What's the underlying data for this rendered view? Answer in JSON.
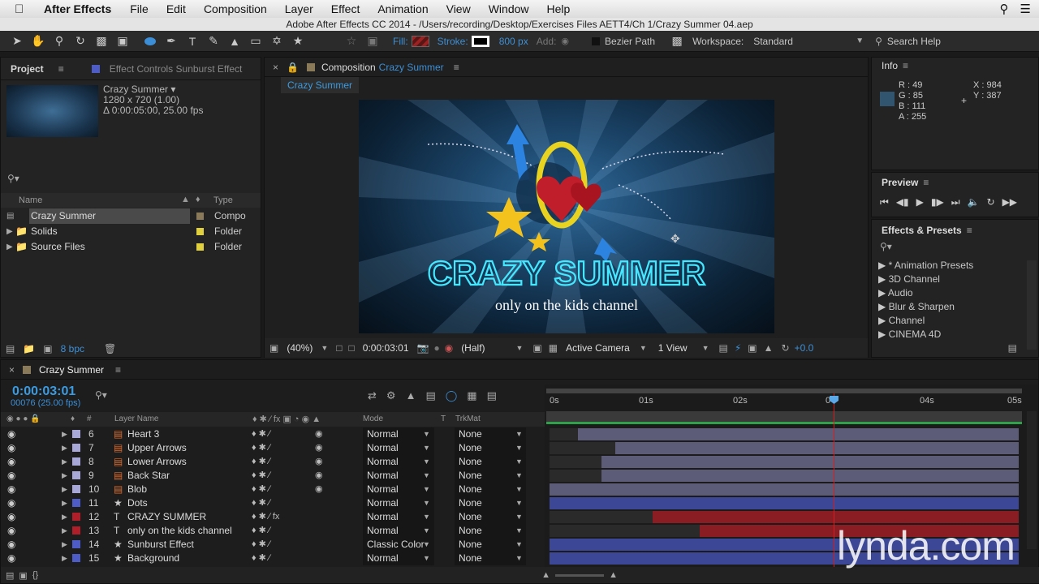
{
  "menubar": {
    "app_name": "After Effects",
    "items": [
      "File",
      "Edit",
      "Composition",
      "Layer",
      "Effect",
      "Animation",
      "View",
      "Window",
      "Help"
    ]
  },
  "titlebar": {
    "title": "Adobe After Effects CC 2014 - /Users/recording/Desktop/Exercises Files AETT4/Ch 1/Crazy Summer 04.aep"
  },
  "toolbar": {
    "fill_label": "Fill:",
    "stroke_label": "Stroke:",
    "stroke_width": "800 px",
    "add_label": "Add:",
    "bezier_label": "Bezier Path",
    "workspace_label": "Workspace:",
    "workspace_value": "Standard",
    "search_placeholder": "Search Help"
  },
  "project": {
    "tab_label": "Project",
    "effect_controls_label": "Effect Controls Sunburst Effect",
    "comp_name": "Crazy Summer ▾",
    "comp_size": "1280 x 720 (1.00)",
    "comp_duration": "Δ 0:00:05:00, 25.00 fps",
    "col_name": "Name",
    "col_type": "Type",
    "items": [
      {
        "name": "Crazy Summer",
        "type": "Compo",
        "color": "#8a7a5a",
        "selected": true
      },
      {
        "name": "Solids",
        "type": "Folder",
        "color": "#e0d040"
      },
      {
        "name": "Source Files",
        "type": "Folder",
        "color": "#e0d040"
      }
    ],
    "bpc": "8 bpc"
  },
  "composition": {
    "tab_prefix": "Composition",
    "tab_name": "Crazy Summer",
    "sub_tab": "Crazy Summer",
    "title_text": "CRAZY SUMMER",
    "subtitle_text": "only on the kids channel",
    "zoom": "(40%)",
    "timecode": "0:00:03:01",
    "resolution": "(Half)",
    "camera": "Active Camera",
    "views": "1 View",
    "exposure": "+0.0"
  },
  "info": {
    "tab_label": "Info",
    "r": "R : 49",
    "g": "G : 85",
    "b": "B : 111",
    "a": "A : 255",
    "x": "X : 984",
    "y": "Y : 387",
    "swatch": "#31556f"
  },
  "preview": {
    "tab_label": "Preview"
  },
  "effects": {
    "tab_label": "Effects & Presets",
    "items": [
      "▶ * Animation Presets",
      "▶ 3D Channel",
      "▶ Audio",
      "▶ Blur & Sharpen",
      "▶ Channel",
      "▶ CINEMA 4D"
    ]
  },
  "timeline": {
    "tab_label": "Crazy Summer",
    "timecode": "0:00:03:01",
    "frame_info": "00076 (25.00 fps)",
    "col_num": "#",
    "col_layer": "Layer Name",
    "col_mode": "Mode",
    "col_t": "T",
    "col_trkmat": "TrkMat",
    "ruler": [
      "0s",
      "01s",
      "02s",
      "0",
      "04s",
      "05s"
    ],
    "layers": [
      {
        "num": "6",
        "name": "Heart 3",
        "mode": "Normal",
        "trk": "None",
        "color": "#a8a8d8",
        "icon": "ai"
      },
      {
        "num": "7",
        "name": "Upper Arrows",
        "mode": "Normal",
        "trk": "None",
        "color": "#a8a8d8",
        "icon": "ai"
      },
      {
        "num": "8",
        "name": "Lower Arrows",
        "mode": "Normal",
        "trk": "None",
        "color": "#a8a8d8",
        "icon": "ai"
      },
      {
        "num": "9",
        "name": "Back Star",
        "mode": "Normal",
        "trk": "None",
        "color": "#a8a8d8",
        "icon": "ai"
      },
      {
        "num": "10",
        "name": "Blob",
        "mode": "Normal",
        "trk": "None",
        "color": "#a8a8d8",
        "icon": "ai"
      },
      {
        "num": "11",
        "name": "Dots",
        "mode": "Normal",
        "trk": "None",
        "color": "#4e5cc8",
        "icon": "star"
      },
      {
        "num": "12",
        "name": "CRAZY SUMMER",
        "mode": "Normal",
        "trk": "None",
        "color": "#b01e2a",
        "icon": "text"
      },
      {
        "num": "13",
        "name": "only on the kids channel",
        "mode": "Normal",
        "trk": "None",
        "color": "#b01e2a",
        "icon": "text"
      },
      {
        "num": "14",
        "name": "Sunburst Effect",
        "mode": "Classic Color",
        "trk": "None",
        "color": "#4e5cc8",
        "icon": "star"
      },
      {
        "num": "15",
        "name": "Background",
        "mode": "Normal",
        "trk": "None",
        "color": "#4e5cc8",
        "icon": "star"
      }
    ]
  },
  "watermark": "lynda.com"
}
